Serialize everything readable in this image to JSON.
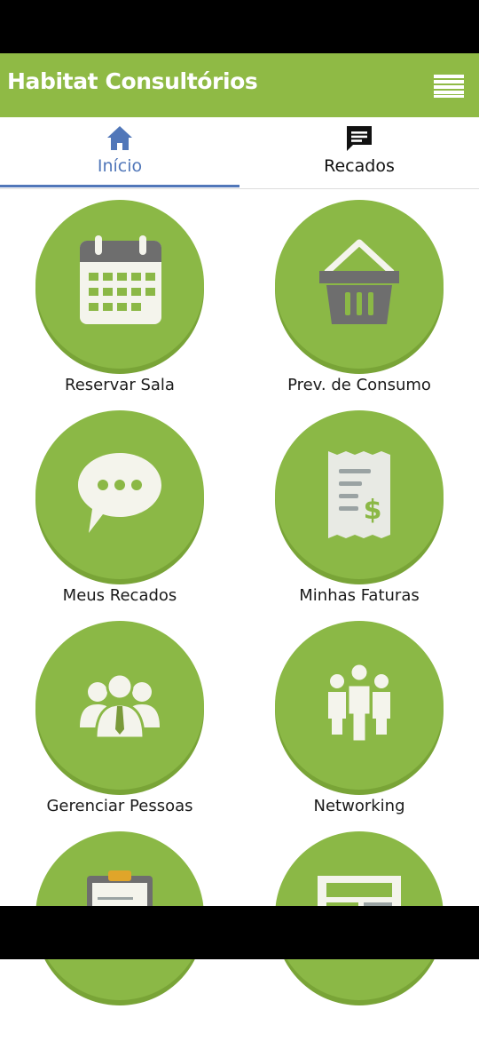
{
  "app_bar": {
    "title": "Habitat Consultórios",
    "menu_icon": "hamburger-menu-icon"
  },
  "tabs": [
    {
      "label": "Início",
      "icon": "home-icon",
      "active": true
    },
    {
      "label": "Recados",
      "icon": "message-icon",
      "active": false
    }
  ],
  "grid": [
    {
      "label": "Reservar Sala",
      "icon": "calendar-icon"
    },
    {
      "label": "Prev. de Consumo",
      "icon": "basket-icon"
    },
    {
      "label": "Meus Recados",
      "icon": "speech-bubble-icon"
    },
    {
      "label": "Minhas Faturas",
      "icon": "invoice-icon"
    },
    {
      "label": "Gerenciar Pessoas",
      "icon": "people-manager-icon"
    },
    {
      "label": "Networking",
      "icon": "networking-people-icon"
    },
    {
      "label": "",
      "icon": "clipboard-icon"
    },
    {
      "label": "",
      "icon": "newspaper-icon"
    }
  ],
  "colors": {
    "primary_green": "#8fba45",
    "tab_active_blue": "#5177b9"
  }
}
